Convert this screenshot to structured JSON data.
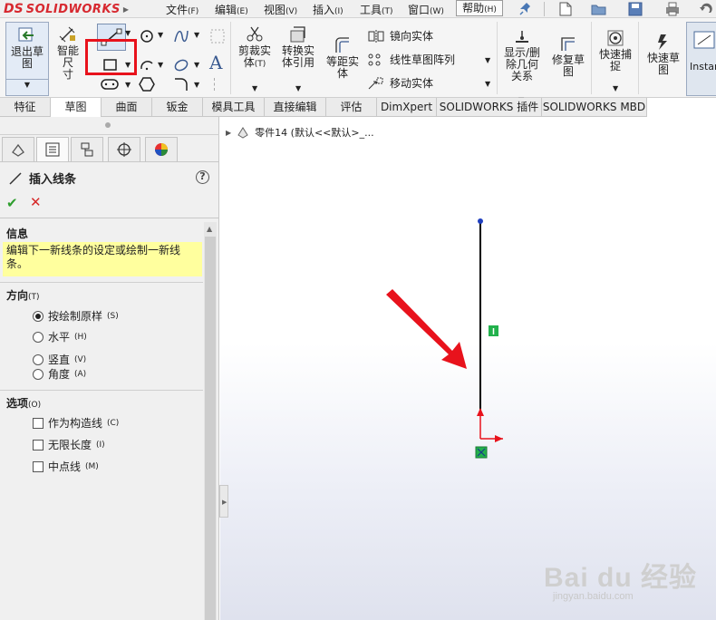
{
  "app": {
    "logo_ds": "DS",
    "logo_text": "SOLIDWORKS"
  },
  "menu": [
    {
      "label": "文件",
      "key": "(F)"
    },
    {
      "label": "编辑",
      "key": "(E)"
    },
    {
      "label": "视图",
      "key": "(V)"
    },
    {
      "label": "插入",
      "key": "(I)"
    },
    {
      "label": "工具",
      "key": "(T)"
    },
    {
      "label": "窗口",
      "key": "(W)"
    },
    {
      "label": "帮助",
      "key": "(H)"
    }
  ],
  "ribbon": {
    "exit_sketch": "退出草图",
    "smart_dimension_1": "智能尺",
    "smart_dimension_2": "寸",
    "trim_1": "剪裁实",
    "trim_2": "体",
    "trim_key": "(T)",
    "convert_1": "转换实",
    "convert_2": "体引用",
    "offset_1": "等距实",
    "offset_2": "体",
    "mirror": "镜向实体",
    "linear_pattern": "线性草图阵列",
    "move": "移动实体",
    "relations_1": "显示/删",
    "relations_2": "除几何",
    "relations_3": "关系",
    "repair_1": "修复草",
    "repair_2": "图",
    "quick_snaps_1": "快速捕",
    "quick_snaps_2": "捉",
    "rapid_sketch_1": "快速草",
    "rapid_sketch_2": "图",
    "instant2d": "Instan"
  },
  "tabs": [
    "特征",
    "草图",
    "曲面",
    "钣金",
    "模具工具",
    "直接编辑",
    "评估",
    "DimXpert",
    "SOLIDWORKS 插件",
    "SOLIDWORKS MBD"
  ],
  "active_tab_index": 1,
  "property_manager": {
    "title": "插入线条",
    "help": "?",
    "ok": "✔",
    "cancel": "✕",
    "info_title": "信息",
    "info_text": "编辑下一新线条的设定或绘制一新线条。",
    "orientation_title": "方向",
    "orientation_key": "(T)",
    "orientation_options": [
      {
        "label": "按绘制原样",
        "key": "(S)",
        "selected": true
      },
      {
        "label": "水平",
        "key": "(H)",
        "selected": false
      },
      {
        "label": "竖直",
        "key": "(V)",
        "selected": false
      },
      {
        "label": "角度",
        "key": "(A)",
        "selected": false
      }
    ],
    "options_title": "选项",
    "options_key": "(O)",
    "options": [
      {
        "label": "作为构造线",
        "key": "(C)",
        "checked": false
      },
      {
        "label": "无限长度",
        "key": "(I)",
        "checked": false
      },
      {
        "label": "中点线",
        "key": "(M)",
        "checked": false
      }
    ]
  },
  "graphics": {
    "tree_path": "零件14  (默认<<默认>_..."
  },
  "watermark": {
    "main": "Bai du 经验",
    "sub": "jingyan.baidu.com"
  },
  "colors": {
    "highlight_box": "#e8121c",
    "info_bg": "#ffff9e",
    "arrow": "#e8121c",
    "sketch_line": "#000000",
    "relation_badge": "#22b14c"
  }
}
